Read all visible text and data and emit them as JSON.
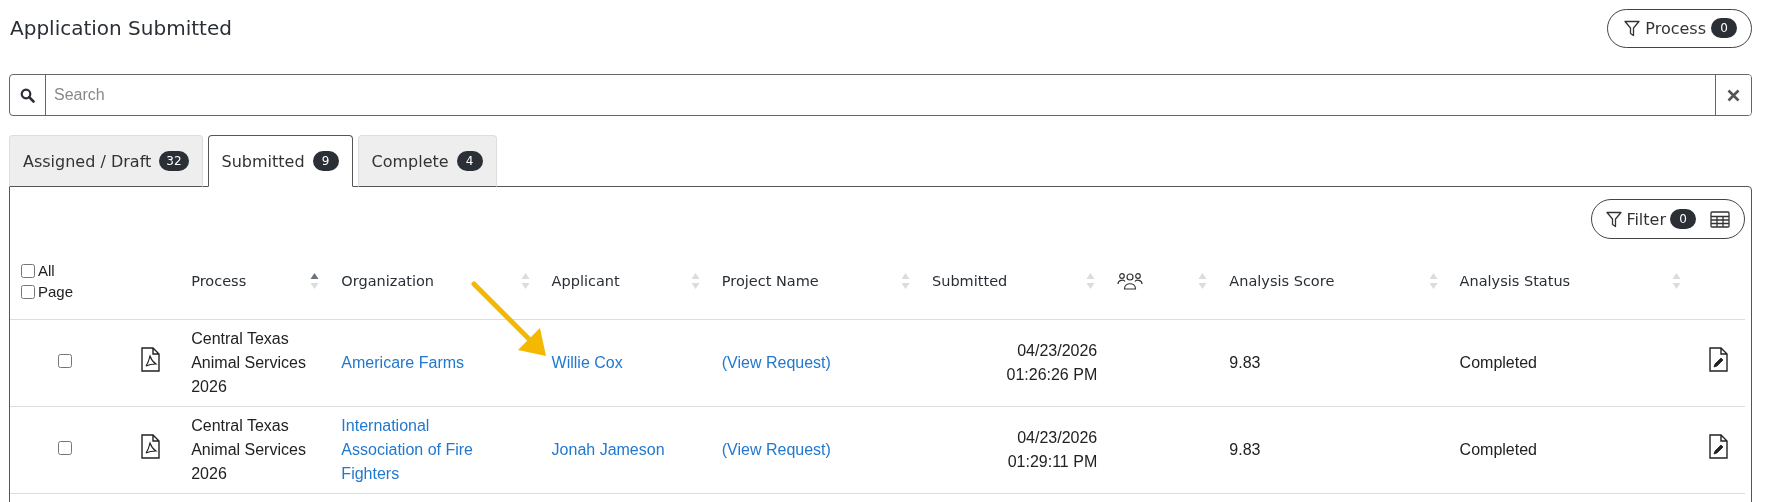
{
  "title": "Application Submitted",
  "process_filter": {
    "label": "Process",
    "count": "0"
  },
  "search": {
    "placeholder": "Search"
  },
  "tabs": [
    {
      "label": "Assigned / Draft",
      "count": "32",
      "selected": false
    },
    {
      "label": "Submitted",
      "count": "9",
      "selected": true
    },
    {
      "label": "Complete",
      "count": "4",
      "selected": false
    }
  ],
  "table_filter": {
    "label": "Filter",
    "count": "0"
  },
  "select_checks": [
    {
      "label": "All",
      "checked": false
    },
    {
      "label": "Page",
      "checked": false
    }
  ],
  "columns": [
    {
      "kind": "text",
      "label": "Process",
      "sorted_ascending": true
    },
    {
      "kind": "text",
      "label": "Organization",
      "sorted_ascending": false
    },
    {
      "kind": "text",
      "label": "Applicant",
      "sorted_ascending": false
    },
    {
      "kind": "text",
      "label": "Project Name",
      "sorted_ascending": false
    },
    {
      "kind": "text",
      "label": "Submitted",
      "sorted_ascending": false
    },
    {
      "kind": "people",
      "sorted_ascending": false
    },
    {
      "kind": "text",
      "label": "Analysis Score",
      "sorted_ascending": false
    },
    {
      "kind": "text",
      "label": "Analysis Status",
      "sorted_ascending": false
    }
  ],
  "rows": [
    {
      "checked": false,
      "process": "Central Texas Animal Services 2026",
      "organization": "Americare Farms",
      "applicant": "Willie Cox",
      "project": "(View Request)",
      "date": "04/23/2026",
      "time": "01:26:26 PM",
      "score": "9.83",
      "status": "Completed"
    },
    {
      "checked": false,
      "process": "Central Texas Animal Services 2026",
      "organization": "International Association of Fire Fighters",
      "applicant": "Jonah Jameson",
      "project": "(View Request)",
      "date": "04/23/2026",
      "time": "01:29:11 PM",
      "score": "9.83",
      "status": "Completed"
    }
  ]
}
